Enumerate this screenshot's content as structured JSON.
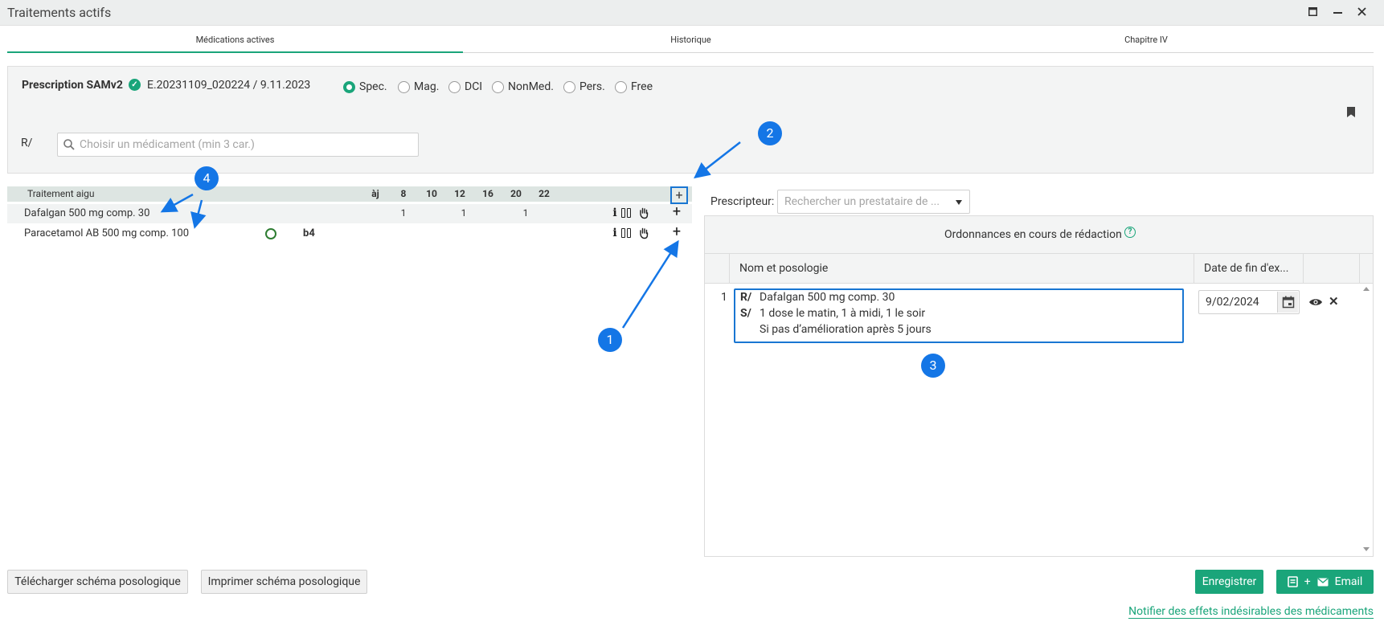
{
  "window": {
    "title": "Traitements actifs",
    "controls": [
      "maximize",
      "minimize",
      "close"
    ]
  },
  "tabs": [
    {
      "label": "Médications actives",
      "active": true
    },
    {
      "label": "Historique",
      "active": false
    },
    {
      "label": "Chapitre IV",
      "active": false
    }
  ],
  "prescription": {
    "label": "Prescription SAMv2",
    "id": "E.20231109_020224 / 9.11.2023",
    "type_options": [
      {
        "label": "Spec.",
        "selected": true
      },
      {
        "label": "Mag.",
        "selected": false
      },
      {
        "label": "DCI",
        "selected": false
      },
      {
        "label": "NonMed.",
        "selected": false
      },
      {
        "label": "Pers.",
        "selected": false
      },
      {
        "label": "Free",
        "selected": false
      }
    ],
    "r_label": "R/",
    "search_placeholder": "Choisir un médicament (min 3 car.)"
  },
  "treatment_table": {
    "section_title": "Traitement aigu",
    "hour_headers": [
      "àj",
      "8",
      "10",
      "12",
      "16",
      "20",
      "22"
    ],
    "rows": [
      {
        "name": "Dafalgan 500 mg comp. 30",
        "doses": {
          "8": "1",
          "12": "1",
          "20": "1"
        }
      },
      {
        "name": "Paracetamol AB 500 mg comp. 100",
        "tag": "b4"
      }
    ]
  },
  "prescriber": {
    "label": "Prescripteur:",
    "placeholder": "Rechercher un prestataire de ..."
  },
  "ordonnances": {
    "title": "Ordonnances en cours de rédaction",
    "columns": [
      "Nom et posologie",
      "Date de fin d'ex..."
    ],
    "rows": [
      {
        "num": "1",
        "r_label": "R/",
        "r_text": "Dafalgan 500 mg comp. 30",
        "s_label": "S/",
        "s_text": "1 dose le matin, 1 à midi, 1 le soir",
        "s_text2": "Si pas d’amélioration après 5 jours",
        "end_date": "9/02/2024"
      }
    ]
  },
  "buttons": {
    "download_schema": "Télécharger schéma posologique",
    "print_schema": "Imprimer schéma posologique",
    "save": "Enregistrer",
    "email_plus": "+",
    "email": "Email"
  },
  "notify_link": "Notifier des effets indésirables des médicaments",
  "annotations": [
    "1",
    "2",
    "3",
    "4"
  ],
  "colors": {
    "accent": "#1aa57a",
    "callout": "#1476e6",
    "focus": "#1976d2"
  }
}
